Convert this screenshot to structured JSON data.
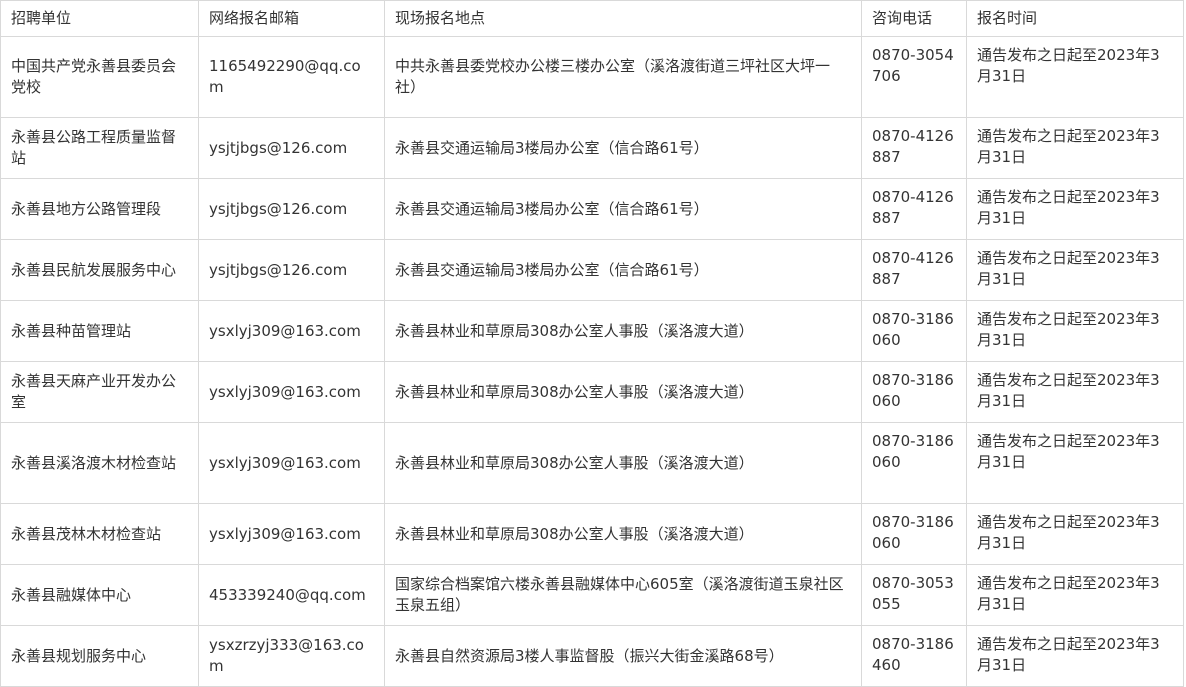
{
  "table": {
    "headers": [
      "招聘单位",
      "网络报名邮箱",
      "现场报名地点",
      "咨询电话",
      "报名时间"
    ],
    "rows": [
      {
        "unit": "中国共产党永善县委员会党校",
        "email": "1165492290@qq.com",
        "location": "中共永善县委党校办公楼三楼办公室（溪洛渡街道三坪社区大坪一社）",
        "phone": "0870-3054706",
        "time": "通告发布之日起至2023年3月31日"
      },
      {
        "unit": "永善县公路工程质量监督站",
        "email": "ysjtjbgs@126.com",
        "location": "永善县交通运输局3楼局办公室（信合路61号）",
        "phone": "0870-4126887",
        "time": "通告发布之日起至2023年3月31日"
      },
      {
        "unit": "永善县地方公路管理段",
        "email": "ysjtjbgs@126.com",
        "location": "永善县交通运输局3楼局办公室（信合路61号）",
        "phone": "0870-4126887",
        "time": "通告发布之日起至2023年3月31日"
      },
      {
        "unit": "永善县民航发展服务中心",
        "email": "ysjtjbgs@126.com",
        "location": "永善县交通运输局3楼局办公室（信合路61号）",
        "phone": "0870-4126887",
        "time": "通告发布之日起至2023年3月31日"
      },
      {
        "unit": "永善县种苗管理站",
        "email": "ysxlyj309@163.com",
        "location": "永善县林业和草原局308办公室人事股（溪洛渡大道）",
        "phone": "0870-3186060",
        "time": "通告发布之日起至2023年3月31日"
      },
      {
        "unit": "永善县天麻产业开发办公室",
        "email": "ysxlyj309@163.com",
        "location": "永善县林业和草原局308办公室人事股（溪洛渡大道）",
        "phone": "0870-3186060",
        "time": "通告发布之日起至2023年3月31日"
      },
      {
        "unit": "永善县溪洛渡木材检查站",
        "email": "ysxlyj309@163.com",
        "location": "永善县林业和草原局308办公室人事股（溪洛渡大道）",
        "phone": "0870-3186060",
        "time": "通告发布之日起至2023年3月31日"
      },
      {
        "unit": "永善县茂林木材检查站",
        "email": "ysxlyj309@163.com",
        "location": "永善县林业和草原局308办公室人事股（溪洛渡大道）",
        "phone": "0870-3186060",
        "time": "通告发布之日起至2023年3月31日"
      },
      {
        "unit": "永善县融媒体中心",
        "email": "453339240@qq.com",
        "location": "国家综合档案馆六楼永善县融媒体中心605室（溪洛渡街道玉泉社区玉泉五组）",
        "phone": "0870-3053055",
        "time": "通告发布之日起至2023年3月31日"
      },
      {
        "unit": "永善县规划服务中心",
        "email": "ysxzrzyj333@163.com",
        "location": "永善县自然资源局3楼人事监督股（振兴大街金溪路68号）",
        "phone": "0870-3186460",
        "time": "通告发布之日起至2023年3月31日"
      }
    ]
  }
}
